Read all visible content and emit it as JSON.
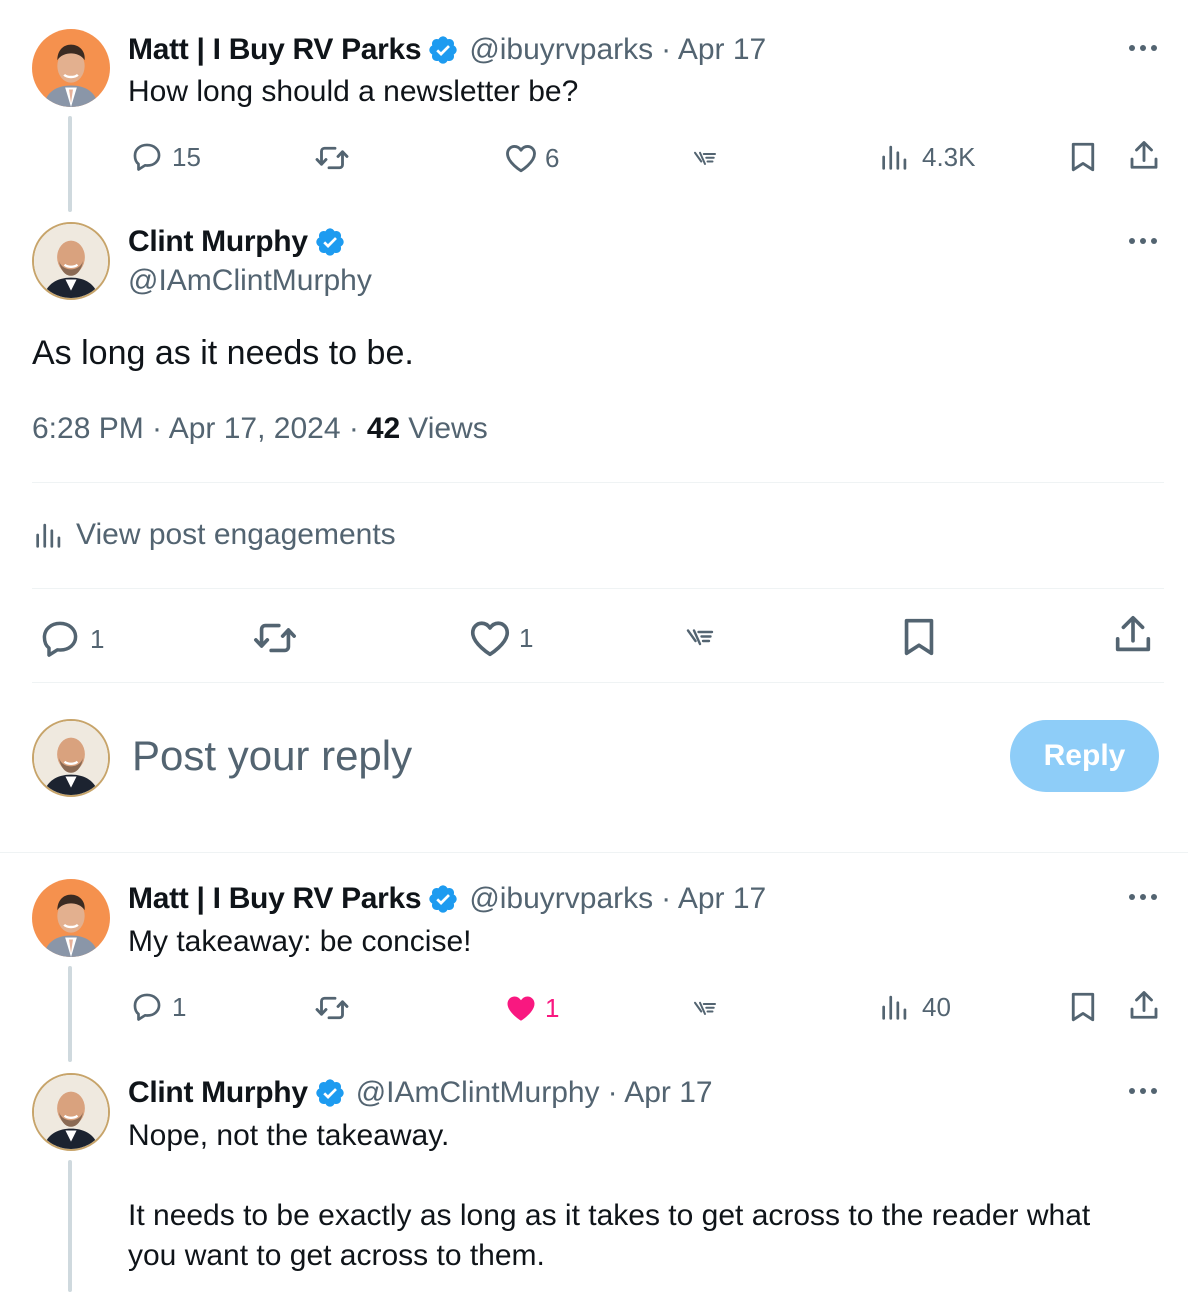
{
  "colors": {
    "text": "#0f1419",
    "muted": "#536471",
    "verified": "#1d9bf0",
    "like": "#f91880",
    "reply_btn": "#8ecdf8"
  },
  "parent_post": {
    "author_name": "Matt | I Buy RV Parks",
    "handle": "@ibuyrvparks",
    "date": "· Apr 17",
    "text": "How long should a newsletter be?",
    "replies": "15",
    "likes": "6",
    "views": "4.3K"
  },
  "main_post": {
    "author_name": "Clint Murphy",
    "handle": "@IAmClintMurphy",
    "text": "As long as it needs to be.",
    "time": "6:28 PM · Apr 17, 2024 ·",
    "views_count": "42",
    "views_label": "Views",
    "engagements_label": "View post engagements",
    "replies": "1",
    "likes": "1"
  },
  "composer": {
    "placeholder": "Post your reply",
    "button_label": "Reply"
  },
  "reply_1": {
    "author_name": "Matt | I Buy RV Parks",
    "handle": "@ibuyrvparks",
    "date": "· Apr 17",
    "text": "My takeaway: be concise!",
    "replies": "1",
    "likes": "1",
    "views": "40"
  },
  "reply_2": {
    "author_name": "Clint Murphy",
    "handle": "@IAmClintMurphy",
    "date": "· Apr 17",
    "text_line1": "Nope, not the takeaway.",
    "text_line2": "It needs to be exactly as long as it takes to get across to the reader what",
    "text_line3": "you want to get across to them."
  },
  "icons": [
    "reply-icon",
    "retweet-icon",
    "like-icon",
    "grok-icon",
    "views-icon",
    "bookmark-icon",
    "share-icon",
    "more-icon",
    "verified-badge-icon"
  ]
}
